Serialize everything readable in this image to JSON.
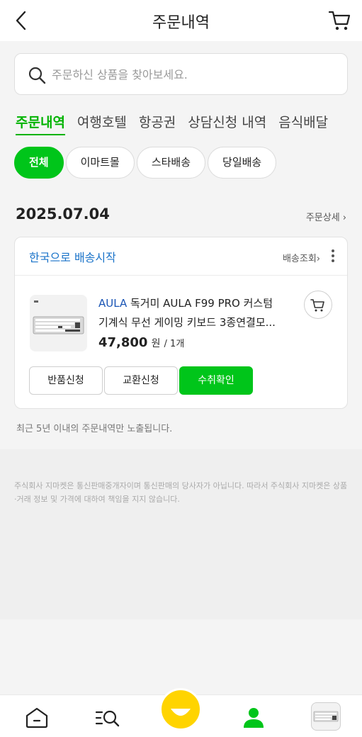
{
  "header": {
    "title": "주문내역"
  },
  "search": {
    "placeholder": "주문하신 상품을 찾아보세요."
  },
  "tabs": [
    {
      "label": "주문내역",
      "active": true
    },
    {
      "label": "여행호텔"
    },
    {
      "label": "항공권"
    },
    {
      "label": "상담신청 내역"
    },
    {
      "label": "음식배달"
    }
  ],
  "filters": [
    {
      "label": "전체",
      "active": true
    },
    {
      "label": "이마트몰"
    },
    {
      "label": "스타배송"
    },
    {
      "label": "당일배송"
    }
  ],
  "order": {
    "date": "2025.07.04",
    "detail_link": "주문상세 ›",
    "shipping_status": "한국으로 배송시작",
    "track_link": "배송조회›",
    "product": {
      "brand": "AULA",
      "name_line1_rest": " 독거미 AULA F99 PRO 커스텀",
      "name_line2": "기계식 무선 게이밍 키보드 3종연결모...",
      "price": "47,800",
      "unit": "원",
      "qty": "/ 1개"
    },
    "buttons": {
      "return": "반품신청",
      "exchange": "교환신청",
      "confirm": "수취확인"
    }
  },
  "notice": "최근 5년 이내의 주문내역만 노출됩니다.",
  "footer": {
    "disclaimer": "주식회사 지마켓은 통신판매중개자이며 통신판매의 당사자가 아닙니다. 따라서 주식회사 지마켓은 상품·거래 정보 및 가격에 대하여 책임을 지지 않습니다."
  },
  "colors": {
    "accent_green": "#00c51a",
    "link_blue": "#1a73c9",
    "smile_yellow": "#ffd400"
  },
  "icons": {
    "back": "chevron-left-icon",
    "cart": "cart-icon",
    "search": "search-icon",
    "more": "more-vertical-icon",
    "home": "home-icon",
    "category_search": "category-search-icon",
    "smile": "smile-icon",
    "my": "person-icon"
  }
}
